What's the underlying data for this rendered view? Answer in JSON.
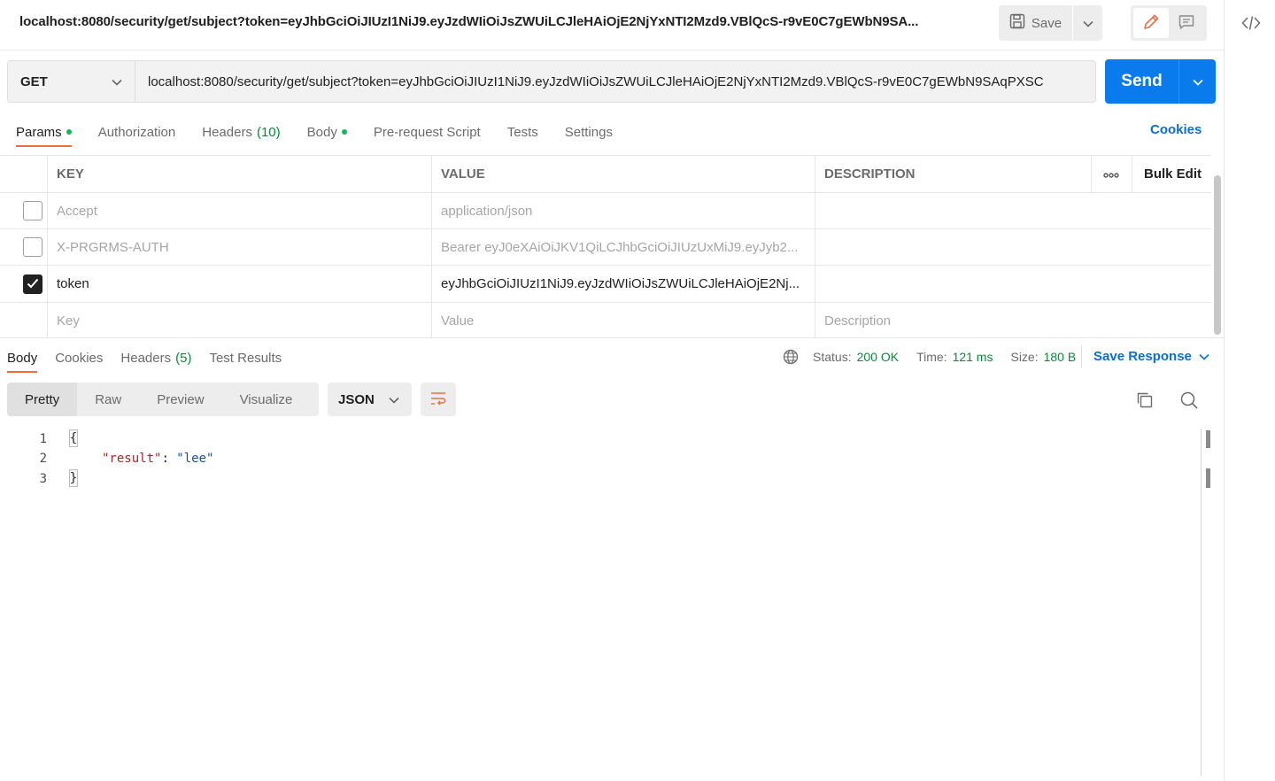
{
  "title_bar": {
    "url_title": "localhost:8080/security/get/subject?token=eyJhbGciOiJIUzI1NiJ9.eyJzdWIiOiJsZWUiLCJleHAiOjE2NjYxNTI2Mzd9.VBlQcS-r9vE0C7gEWbN9SA...",
    "save_label": "Save"
  },
  "request": {
    "method": "GET",
    "url": "localhost:8080/security/get/subject?token=eyJhbGciOiJIUzI1NiJ9.eyJzdWIiOiJsZWUiLCJleHAiOjE2NjYxNTI2Mzd9.VBlQcS-r9vE0C7gEWbN9SAqPXSC",
    "send_label": "Send"
  },
  "request_tabs": {
    "params": "Params",
    "authorization": "Authorization",
    "headers": "Headers",
    "headers_count": "(10)",
    "body": "Body",
    "pre_request": "Pre-request Script",
    "tests": "Tests",
    "settings": "Settings",
    "cookies": "Cookies"
  },
  "params_table": {
    "headers": {
      "key": "KEY",
      "value": "VALUE",
      "description": "DESCRIPTION",
      "bulk_edit": "Bulk Edit"
    },
    "rows": [
      {
        "key": "Accept",
        "value": "application/json",
        "description": "",
        "checked": false
      },
      {
        "key": "X-PRGRMS-AUTH",
        "value": "Bearer eyJ0eXAiOiJKV1QiLCJhbGciOiJIUzUxMiJ9.eyJyb2...",
        "description": "",
        "checked": false
      },
      {
        "key": "token",
        "value": "eyJhbGciOiJIUzI1NiJ9.eyJzdWIiOiJsZWUiLCJleHAiOjE2Nj...",
        "description": "",
        "checked": true
      }
    ],
    "placeholders": {
      "key": "Key",
      "value": "Value",
      "description": "Description"
    }
  },
  "response": {
    "tabs": {
      "body": "Body",
      "cookies": "Cookies",
      "headers": "Headers",
      "headers_count": "(5)",
      "test_results": "Test Results"
    },
    "status_label": "Status:",
    "status_value": "200 OK",
    "time_label": "Time:",
    "time_value": "121 ms",
    "size_label": "Size:",
    "size_value": "180 B",
    "save_response": "Save Response",
    "views": {
      "pretty": "Pretty",
      "raw": "Raw",
      "preview": "Preview",
      "visualize": "Visualize"
    },
    "format": "JSON",
    "code": {
      "line1_no": "1",
      "line2_no": "2",
      "line3_no": "3",
      "open_brace": "{",
      "key": "\"result\"",
      "colon": ": ",
      "value": "\"lee\"",
      "close_brace": "}"
    }
  },
  "colors": {
    "accent_blue": "#097bed",
    "link_blue": "#0b6fd4",
    "tab_underline": "#f26b3a",
    "status_green": "#0a8a3c",
    "dot_green": "#0cbb52"
  },
  "icons": [
    "save-icon",
    "chevron-down-icon",
    "pencil-icon",
    "comment-icon",
    "code-icon",
    "globe-icon",
    "copy-icon",
    "search-icon",
    "wrap-lines-icon",
    "checkmark-icon",
    "more-horizontal-icon"
  ]
}
